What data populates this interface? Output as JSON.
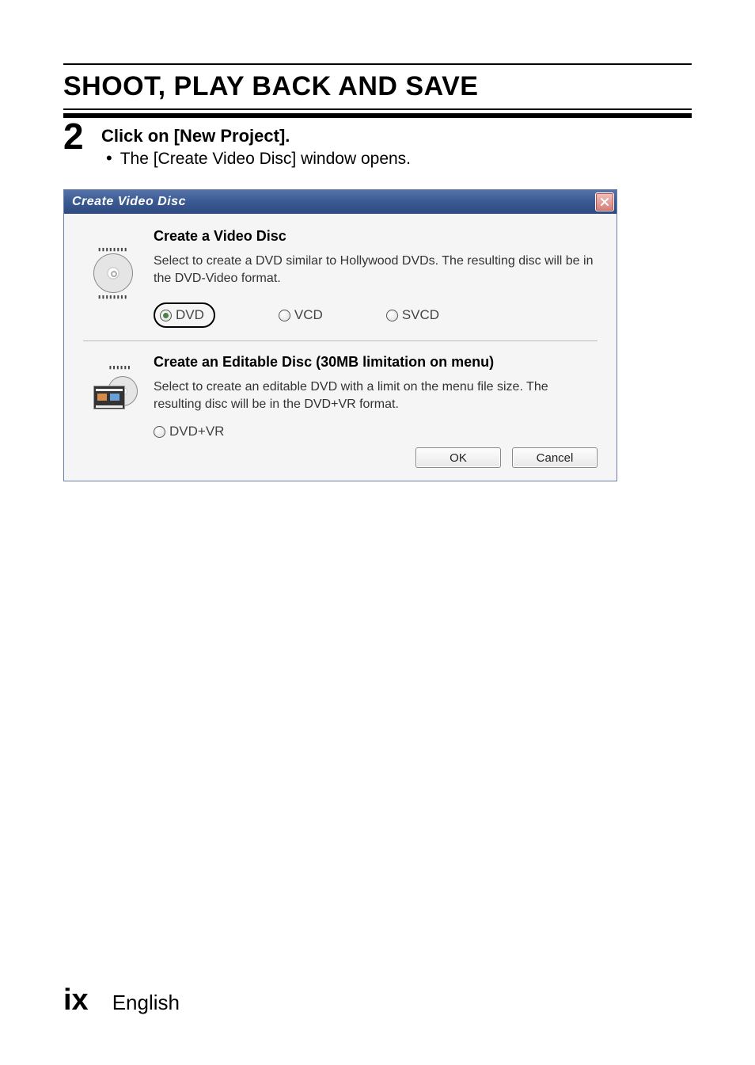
{
  "page": {
    "title": "SHOOT, PLAY BACK AND SAVE",
    "footer_number": "ix",
    "footer_language": "English"
  },
  "step": {
    "number": "2",
    "title": "Click on [New Project].",
    "sub": "The [Create Video Disc] window opens."
  },
  "dialog": {
    "title": "Create Video Disc",
    "section1": {
      "heading": "Create a Video Disc",
      "desc": "Select to create a DVD similar to Hollywood DVDs. The resulting disc will be in the DVD-Video format.",
      "options": {
        "dvd": "DVD",
        "vcd": "VCD",
        "svcd": "SVCD"
      }
    },
    "section2": {
      "heading": "Create an Editable Disc (30MB limitation on menu)",
      "desc": "Select to create an editable DVD with a limit on the menu file size. The resulting disc will be in the DVD+VR format.",
      "option": "DVD+VR"
    },
    "buttons": {
      "ok": "OK",
      "cancel": "Cancel"
    }
  }
}
